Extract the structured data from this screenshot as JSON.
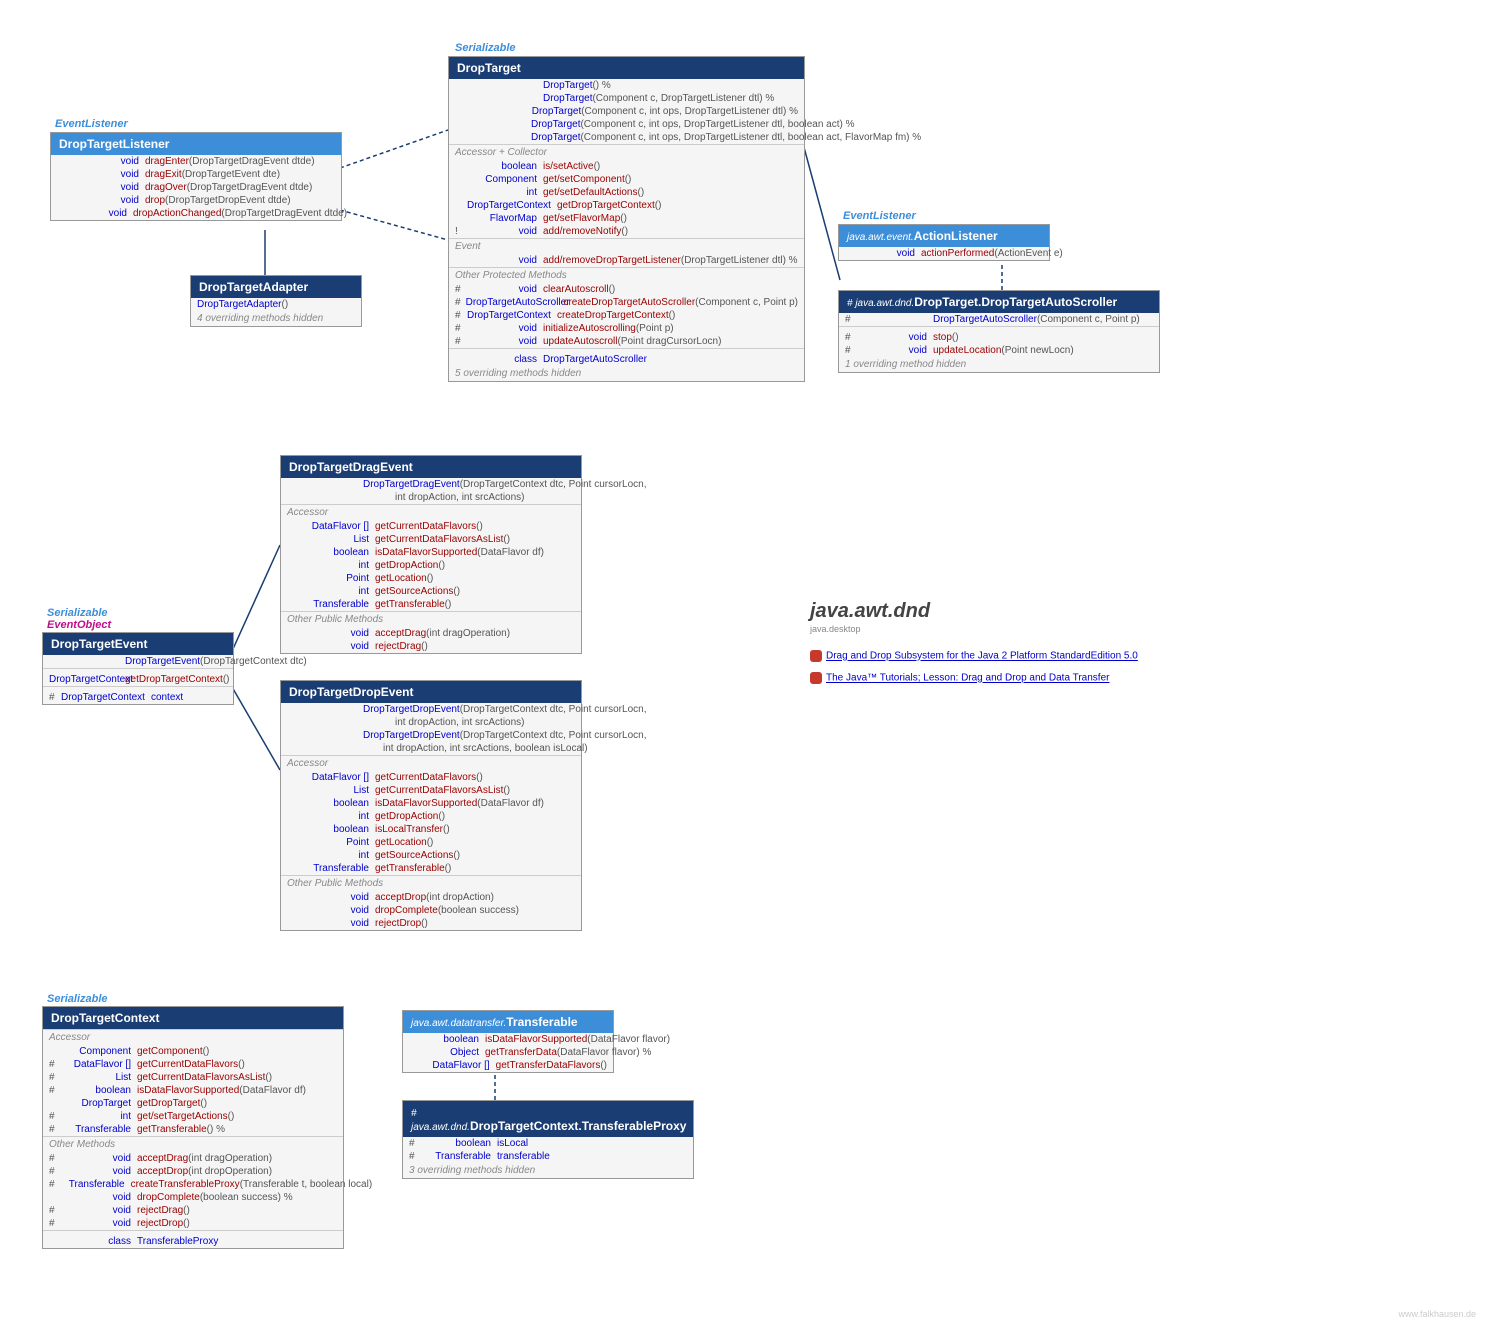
{
  "package": {
    "title": "java.awt.dnd",
    "sub": "java.desktop"
  },
  "links": [
    {
      "text": "Drag and Drop Subsystem for the Java 2 Platform StandardEdition 5.0"
    },
    {
      "text": "The Java™ Tutorials; Lesson: Drag and Drop and Data Transfer"
    }
  ],
  "stereotypes": {
    "eventListener": "EventListener",
    "serializable": "Serializable",
    "eventObject": "EventObject"
  },
  "dropTargetListener": {
    "title": "DropTargetListener",
    "m": [
      {
        "ret": "void",
        "name": "dragEnter",
        "params": "(DropTargetDragEvent dtde)"
      },
      {
        "ret": "void",
        "name": "dragExit",
        "params": "(DropTargetEvent dte)"
      },
      {
        "ret": "void",
        "name": "dragOver",
        "params": "(DropTargetDragEvent dtde)"
      },
      {
        "ret": "void",
        "name": "drop",
        "params": "(DropTargetDropEvent dtde)"
      },
      {
        "ret": "void",
        "name": "dropActionChanged",
        "params": "(DropTargetDragEvent dtde)"
      }
    ]
  },
  "dropTargetAdapter": {
    "title": "DropTargetAdapter",
    "ctor": "DropTargetAdapter",
    "hidden": "4 overriding methods hidden"
  },
  "dropTarget": {
    "title": "DropTarget",
    "ctors": [
      {
        "name": "DropTarget",
        "params": "() %"
      },
      {
        "name": "DropTarget",
        "params": "(Component c, DropTargetListener dtl) %"
      },
      {
        "name": "DropTarget",
        "params": "(Component c, int ops, DropTargetListener dtl) %"
      },
      {
        "name": "DropTarget",
        "params": "(Component c, int ops, DropTargetListener dtl, boolean act) %"
      },
      {
        "name": "DropTarget",
        "params": "(Component c, int ops, DropTargetListener dtl, boolean act, FlavorMap fm) %"
      }
    ],
    "s1": "Accessor + Collector",
    "acc": [
      {
        "ret": "boolean",
        "name": "is/setActive",
        "params": "()"
      },
      {
        "ret": "Component",
        "name": "get/setComponent",
        "params": "()"
      },
      {
        "ret": "int",
        "name": "get/setDefaultActions",
        "params": "()"
      },
      {
        "ret": "DropTargetContext",
        "name": "getDropTargetContext",
        "params": "()"
      },
      {
        "ret": "FlavorMap",
        "name": "get/setFlavorMap",
        "params": "()"
      },
      {
        "vis": "!",
        "ret": "void",
        "name": "add/removeNotify",
        "params": "()"
      }
    ],
    "s2": "Event",
    "ev": [
      {
        "ret": "void",
        "name": "add/removeDropTargetListener",
        "params": "(DropTargetListener dtl) %"
      }
    ],
    "s3": "Other Protected Methods",
    "prot": [
      {
        "vis": "#",
        "ret": "void",
        "name": "clearAutoscroll",
        "params": "()"
      },
      {
        "vis": "#",
        "ret": "DropTargetAutoScroller",
        "name": "createDropTargetAutoScroller",
        "params": "(Component c, Point p)"
      },
      {
        "vis": "#",
        "ret": "DropTargetContext",
        "name": "createDropTargetContext",
        "params": "()"
      },
      {
        "vis": "#",
        "ret": "void",
        "name": "initializeAutoscrolling",
        "params": "(Point p)"
      },
      {
        "vis": "#",
        "ret": "void",
        "name": "updateAutoscroll",
        "params": "(Point dragCursorLocn)"
      }
    ],
    "inner": "DropTargetAutoScroller",
    "hidden": "5 overriding methods hidden"
  },
  "actionListener": {
    "pkg": "java.awt.event.",
    "title": "ActionListener",
    "m": [
      {
        "ret": "void",
        "name": "actionPerformed",
        "params": "(ActionEvent e)"
      }
    ]
  },
  "autoScroller": {
    "pkg": "# java.awt.dnd.",
    "title": "DropTarget.DropTargetAutoScroller",
    "ctor": {
      "vis": "#",
      "name": "DropTargetAutoScroller",
      "params": "(Component c, Point p)"
    },
    "m": [
      {
        "vis": "#",
        "ret": "void",
        "name": "stop",
        "params": "()"
      },
      {
        "vis": "#",
        "ret": "void",
        "name": "updateLocation",
        "params": "(Point newLocn)"
      }
    ],
    "hidden": "1 overriding method hidden"
  },
  "dropTargetEvent": {
    "title": "DropTargetEvent",
    "ctor": {
      "name": "DropTargetEvent",
      "params": "(DropTargetContext dtc)"
    },
    "acc": [
      {
        "ret": "DropTargetContext",
        "name": "getDropTargetContext",
        "params": "()"
      }
    ],
    "field": {
      "vis": "#",
      "ret": "DropTargetContext",
      "name": "context"
    }
  },
  "dragEvent": {
    "title": "DropTargetDragEvent",
    "ctor": {
      "name": "DropTargetDragEvent",
      "params": "(DropTargetContext dtc, Point cursorLocn,",
      "params2": "int dropAction, int srcActions)"
    },
    "s1": "Accessor",
    "acc": [
      {
        "ret": "DataFlavor []",
        "name": "getCurrentDataFlavors",
        "params": "()"
      },
      {
        "ret": "List<DataFlavor>",
        "name": "getCurrentDataFlavorsAsList",
        "params": "()"
      },
      {
        "ret": "boolean",
        "name": "isDataFlavorSupported",
        "params": "(DataFlavor df)"
      },
      {
        "ret": "int",
        "name": "getDropAction",
        "params": "()"
      },
      {
        "ret": "Point",
        "name": "getLocation",
        "params": "()"
      },
      {
        "ret": "int",
        "name": "getSourceActions",
        "params": "()"
      },
      {
        "ret": "Transferable",
        "name": "getTransferable",
        "params": "()"
      }
    ],
    "s2": "Other Public Methods",
    "pub": [
      {
        "ret": "void",
        "name": "acceptDrag",
        "params": "(int dragOperation)"
      },
      {
        "ret": "void",
        "name": "rejectDrag",
        "params": "()"
      }
    ]
  },
  "dropEvent": {
    "title": "DropTargetDropEvent",
    "ctors": [
      {
        "name": "DropTargetDropEvent",
        "params": "(DropTargetContext dtc, Point cursorLocn,",
        "params2": "int dropAction, int srcActions)"
      },
      {
        "name": "DropTargetDropEvent",
        "params": "(DropTargetContext dtc, Point cursorLocn,",
        "params2": "int dropAction, int srcActions, boolean isLocal)"
      }
    ],
    "s1": "Accessor",
    "acc": [
      {
        "ret": "DataFlavor []",
        "name": "getCurrentDataFlavors",
        "params": "()"
      },
      {
        "ret": "List<DataFlavor>",
        "name": "getCurrentDataFlavorsAsList",
        "params": "()"
      },
      {
        "ret": "boolean",
        "name": "isDataFlavorSupported",
        "params": "(DataFlavor df)"
      },
      {
        "ret": "int",
        "name": "getDropAction",
        "params": "()"
      },
      {
        "ret": "boolean",
        "name": "isLocalTransfer",
        "params": "()"
      },
      {
        "ret": "Point",
        "name": "getLocation",
        "params": "()"
      },
      {
        "ret": "int",
        "name": "getSourceActions",
        "params": "()"
      },
      {
        "ret": "Transferable",
        "name": "getTransferable",
        "params": "()"
      }
    ],
    "s2": "Other Public Methods",
    "pub": [
      {
        "ret": "void",
        "name": "acceptDrop",
        "params": "(int dropAction)"
      },
      {
        "ret": "void",
        "name": "dropComplete",
        "params": "(boolean success)"
      },
      {
        "ret": "void",
        "name": "rejectDrop",
        "params": "()"
      }
    ]
  },
  "dropTargetContext": {
    "title": "DropTargetContext",
    "s1": "Accessor",
    "acc": [
      {
        "ret": "Component",
        "name": "getComponent",
        "params": "()"
      },
      {
        "vis": "#",
        "ret": "DataFlavor []",
        "name": "getCurrentDataFlavors",
        "params": "()"
      },
      {
        "vis": "#",
        "ret": "List<DataFlavor>",
        "name": "getCurrentDataFlavorsAsList",
        "params": "()"
      },
      {
        "vis": "#",
        "ret": "boolean",
        "name": "isDataFlavorSupported",
        "params": "(DataFlavor df)"
      },
      {
        "ret": "DropTarget",
        "name": "getDropTarget",
        "params": "()"
      },
      {
        "vis": "#",
        "ret": "int",
        "name": "get/setTargetActions",
        "params": "()"
      },
      {
        "vis": "#",
        "ret": "Transferable",
        "name": "getTransferable",
        "params": "() %"
      }
    ],
    "s2": "Other Methods",
    "oth": [
      {
        "vis": "#",
        "ret": "void",
        "name": "acceptDrag",
        "params": "(int dragOperation)"
      },
      {
        "vis": "#",
        "ret": "void",
        "name": "acceptDrop",
        "params": "(int dropOperation)"
      },
      {
        "vis": "#",
        "ret": "Transferable",
        "name": "createTransferableProxy",
        "params": "(Transferable t, boolean local)"
      },
      {
        "ret": "void",
        "name": "dropComplete",
        "params": "(boolean success) %"
      },
      {
        "vis": "#",
        "ret": "void",
        "name": "rejectDrag",
        "params": "()"
      },
      {
        "vis": "#",
        "ret": "void",
        "name": "rejectDrop",
        "params": "()"
      }
    ],
    "inner": "TransferableProxy"
  },
  "transferable": {
    "pkg": "java.awt.datatransfer.",
    "title": "Transferable",
    "m": [
      {
        "ret": "boolean",
        "name": "isDataFlavorSupported",
        "params": "(DataFlavor flavor)"
      },
      {
        "ret": "Object",
        "name": "getTransferData",
        "params": "(DataFlavor flavor) %"
      },
      {
        "ret": "DataFlavor []",
        "name": "getTransferDataFlavors",
        "params": "()"
      }
    ]
  },
  "transferableProxy": {
    "pkg": "# java.awt.dnd.",
    "title": "DropTargetContext.TransferableProxy",
    "fields": [
      {
        "vis": "#",
        "ret": "boolean",
        "name": "isLocal"
      },
      {
        "vis": "#",
        "ret": "Transferable",
        "name": "transferable"
      }
    ],
    "hidden": "3 overriding methods hidden"
  },
  "watermark": "www.falkhausen.de"
}
